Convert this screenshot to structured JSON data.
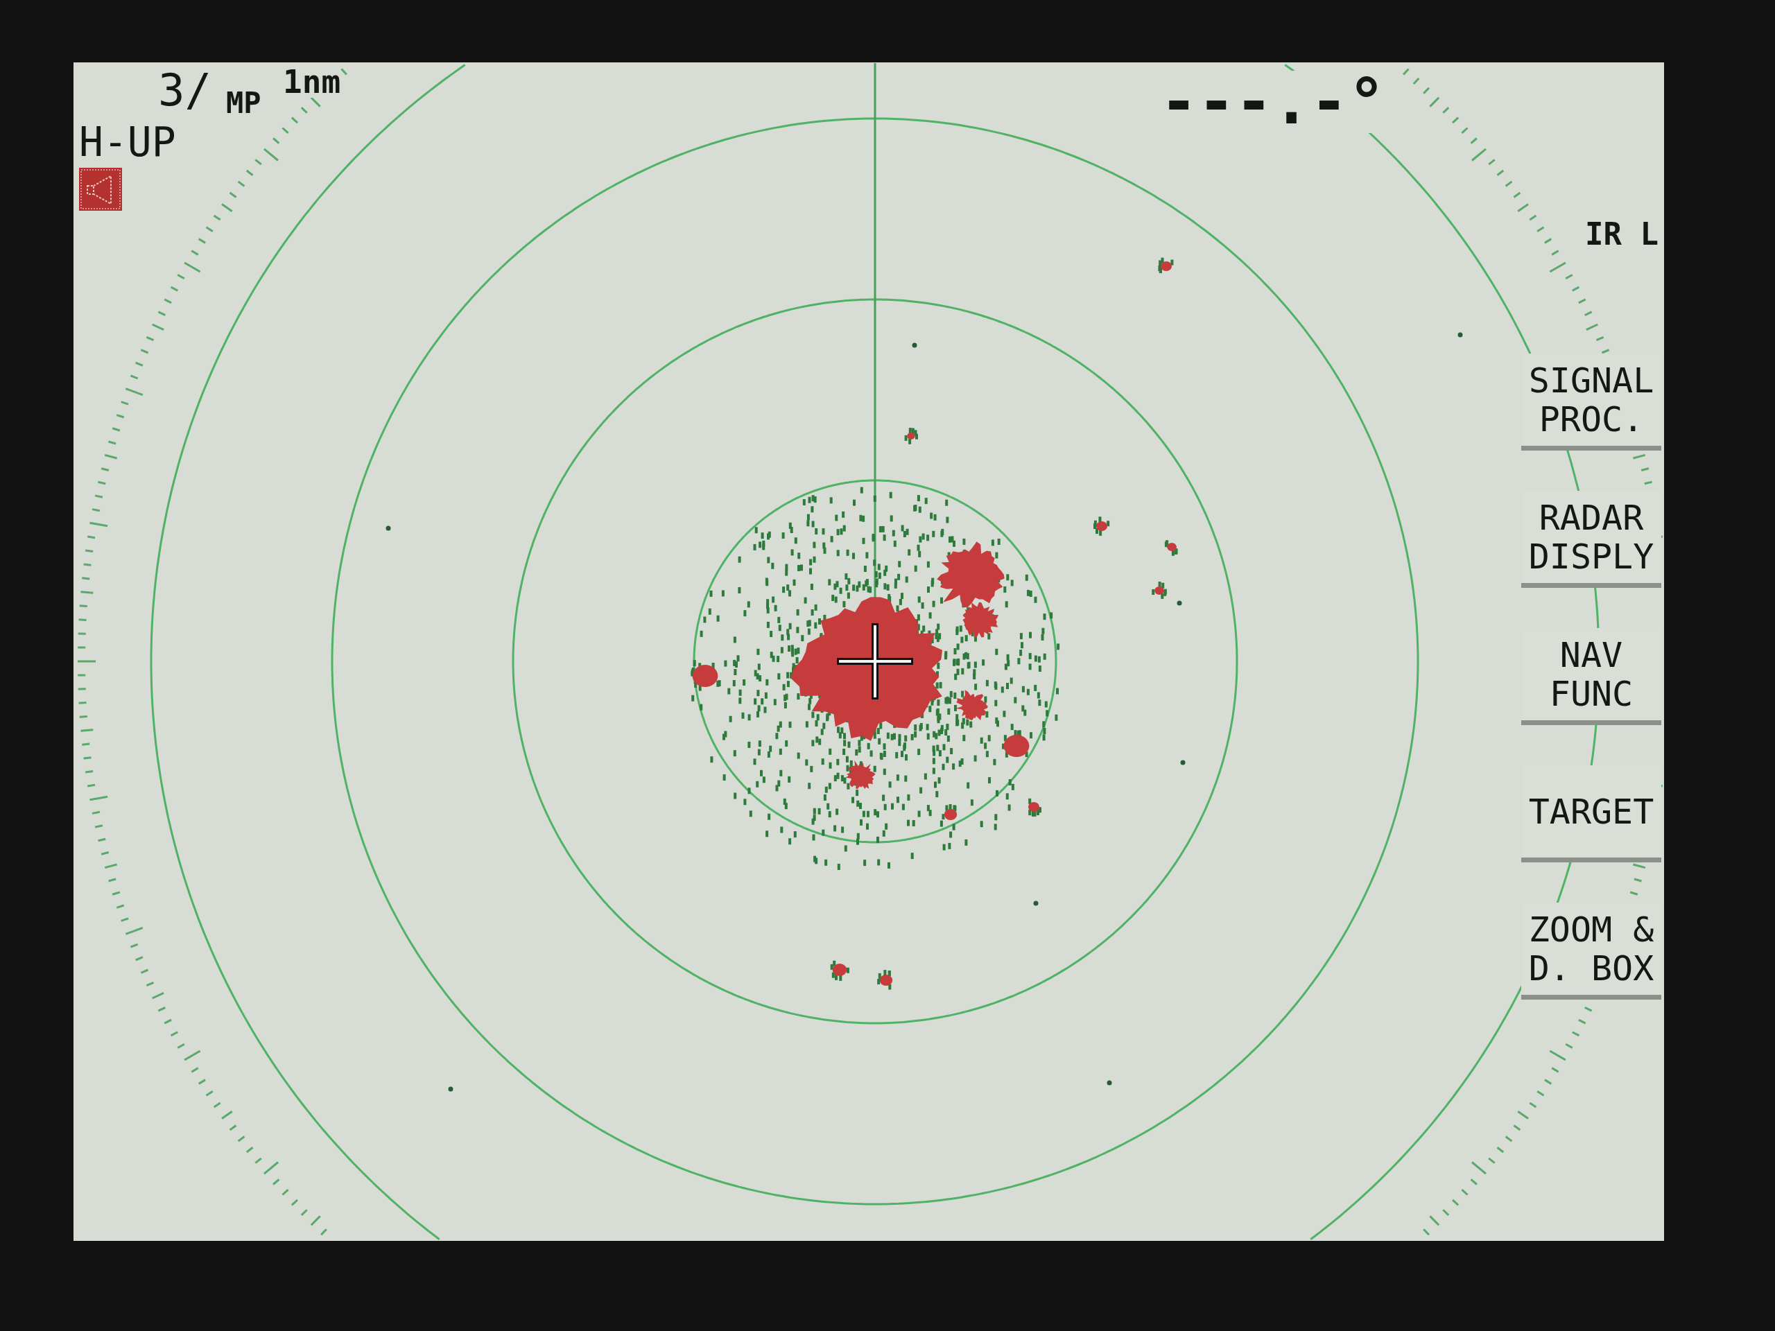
{
  "display": {
    "range_label": "3/",
    "pulse_label": "MP",
    "ring_label": "1nm",
    "orientation": "H-UP",
    "heading_readout": "---.-°",
    "mode_label": "IR L"
  },
  "menu": [
    {
      "lines": [
        "SIGNAL",
        "PROC."
      ]
    },
    {
      "lines": [
        "RADAR",
        "DISPLY"
      ]
    },
    {
      "lines": [
        "NAV",
        "FUNC"
      ]
    },
    {
      "lines": [
        "TARGET"
      ]
    },
    {
      "lines": [
        "ZOOM &",
        "D. BOX"
      ]
    }
  ]
}
